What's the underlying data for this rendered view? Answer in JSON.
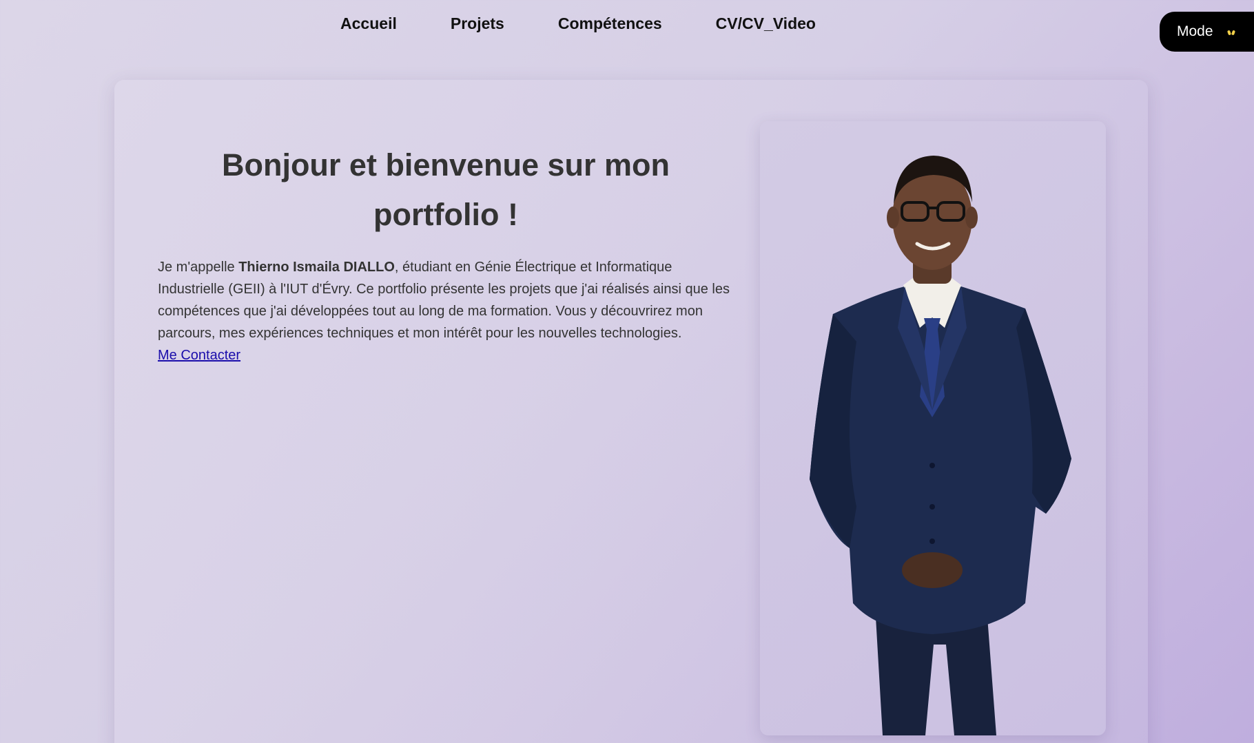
{
  "nav": {
    "items": [
      {
        "label": "Accueil"
      },
      {
        "label": "Projets"
      },
      {
        "label": "Compétences"
      },
      {
        "label": "CV/CV_Video"
      }
    ]
  },
  "mode_button": {
    "label": "Mode",
    "icon": "sun-icon"
  },
  "hero": {
    "title": "Bonjour et bienvenue sur mon portfolio !",
    "intro_prefix": "Je m'appelle ",
    "name": "Thierno Ismaila DIALLO",
    "intro_suffix": ", étudiant en Génie Électrique et Informatique Industrielle (GEII) à l'IUT d'Évry. Ce portfolio présente les projets que j'ai réalisés ainsi que les compétences que j'ai développées tout au long de ma formation. Vous y découvrirez mon parcours, mes expériences techniques et mon intérêt pour les nouvelles technologies.",
    "contact_label": "Me Contacter"
  },
  "colors": {
    "accent": "#1a0dab",
    "text": "#333333",
    "button_bg": "#000000",
    "suit": "#1d2b4f"
  }
}
